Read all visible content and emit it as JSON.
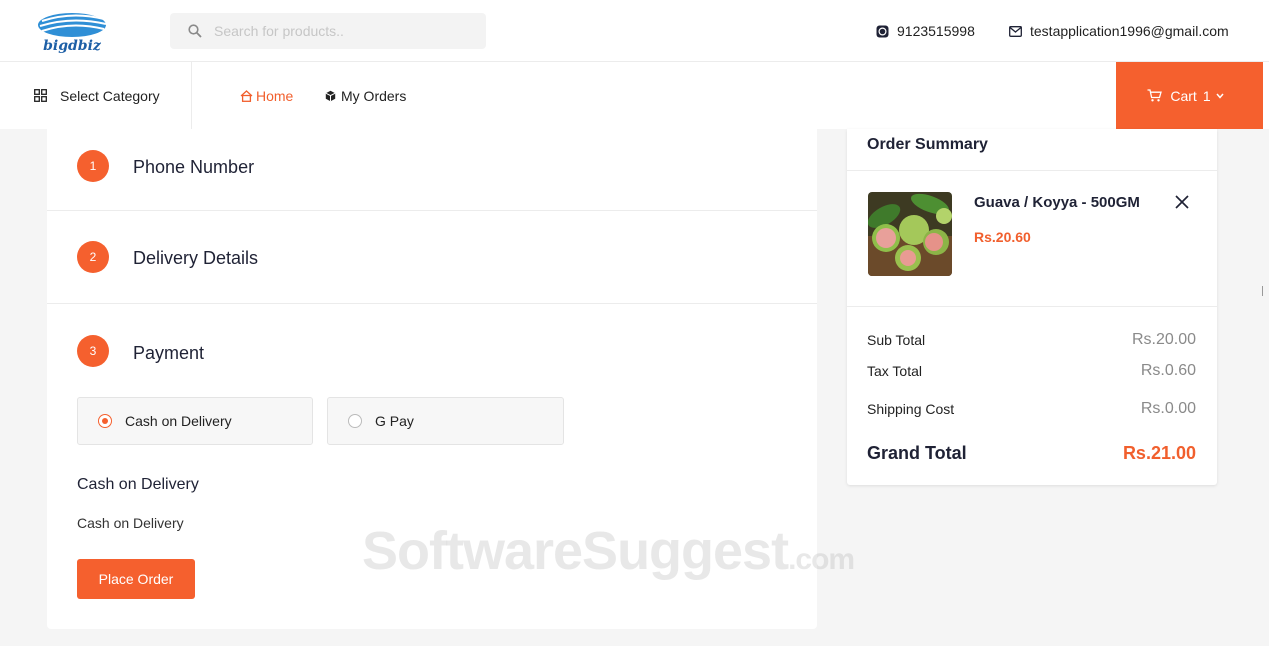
{
  "header": {
    "logo_text": "bigdbiz",
    "search_placeholder": "Search for products..",
    "phone": "9123515998",
    "email": "testapplication1996@gmail.com"
  },
  "nav": {
    "category_label": "Select Category",
    "home_label": "Home",
    "orders_label": "My Orders",
    "cart_label": "Cart",
    "cart_count": "1"
  },
  "checkout": {
    "steps": [
      {
        "number": "1",
        "label": "Phone Number"
      },
      {
        "number": "2",
        "label": "Delivery Details"
      },
      {
        "number": "3",
        "label": "Payment"
      }
    ],
    "payment_options": [
      {
        "label": "Cash on Delivery",
        "selected": true
      },
      {
        "label": "G Pay",
        "selected": false
      }
    ],
    "selected_title": "Cash on Delivery",
    "selected_description": "Cash on Delivery",
    "place_order_label": "Place Order"
  },
  "summary": {
    "title": "Order Summary",
    "item": {
      "name": "Guava / Koyya - 500GM",
      "price": "Rs.20.60",
      "image": "guava-photo"
    },
    "rows": [
      {
        "label": "Sub Total",
        "value": "Rs.20.00"
      },
      {
        "label": "Tax Total",
        "value": "Rs.0.60"
      },
      {
        "label": "Shipping Cost",
        "value": "Rs.0.00"
      }
    ],
    "grand_total_label": "Grand Total",
    "grand_total_value": "Rs.21.00"
  },
  "watermark": {
    "main": "SoftwareSuggest",
    "suffix": ".com"
  },
  "colors": {
    "accent": "#f5602e",
    "text": "#1f2235"
  }
}
